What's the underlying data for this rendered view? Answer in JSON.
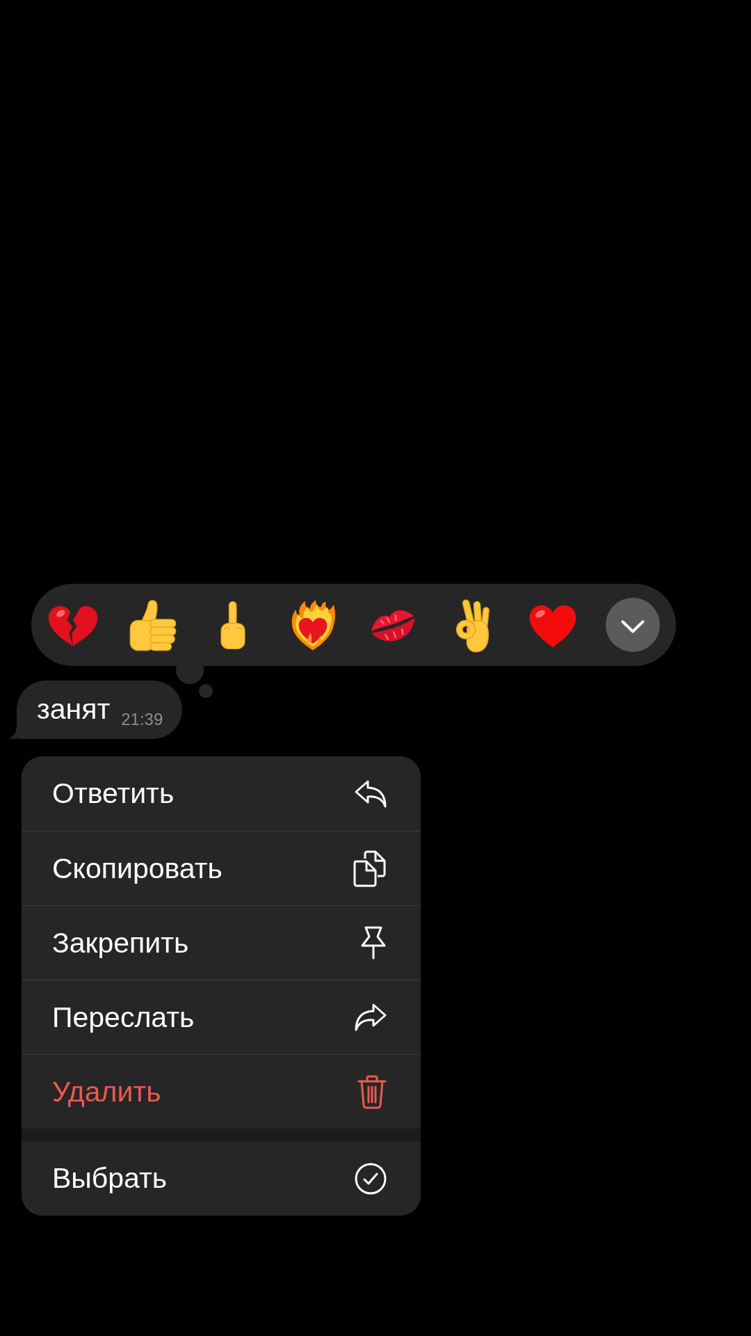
{
  "reaction_bar": {
    "reactions": [
      {
        "kind": "heartbreak"
      },
      {
        "kind": "thumbsup"
      },
      {
        "kind": "finger"
      },
      {
        "kind": "fireheart"
      },
      {
        "kind": "kiss"
      },
      {
        "kind": "okhand"
      },
      {
        "kind": "heart"
      }
    ]
  },
  "message": {
    "text": "занят",
    "time": "21:39"
  },
  "menu": {
    "groups": [
      {
        "items": [
          {
            "label": "Ответить",
            "kind": "reply",
            "destructive": false
          },
          {
            "label": "Скопировать",
            "kind": "copy",
            "destructive": false
          },
          {
            "label": "Закрепить",
            "kind": "pin",
            "destructive": false
          },
          {
            "label": "Переслать",
            "kind": "forward",
            "destructive": false
          },
          {
            "label": "Удалить",
            "kind": "delete",
            "destructive": true
          }
        ]
      },
      {
        "items": [
          {
            "label": "Выбрать",
            "kind": "select",
            "destructive": false
          }
        ]
      }
    ]
  }
}
